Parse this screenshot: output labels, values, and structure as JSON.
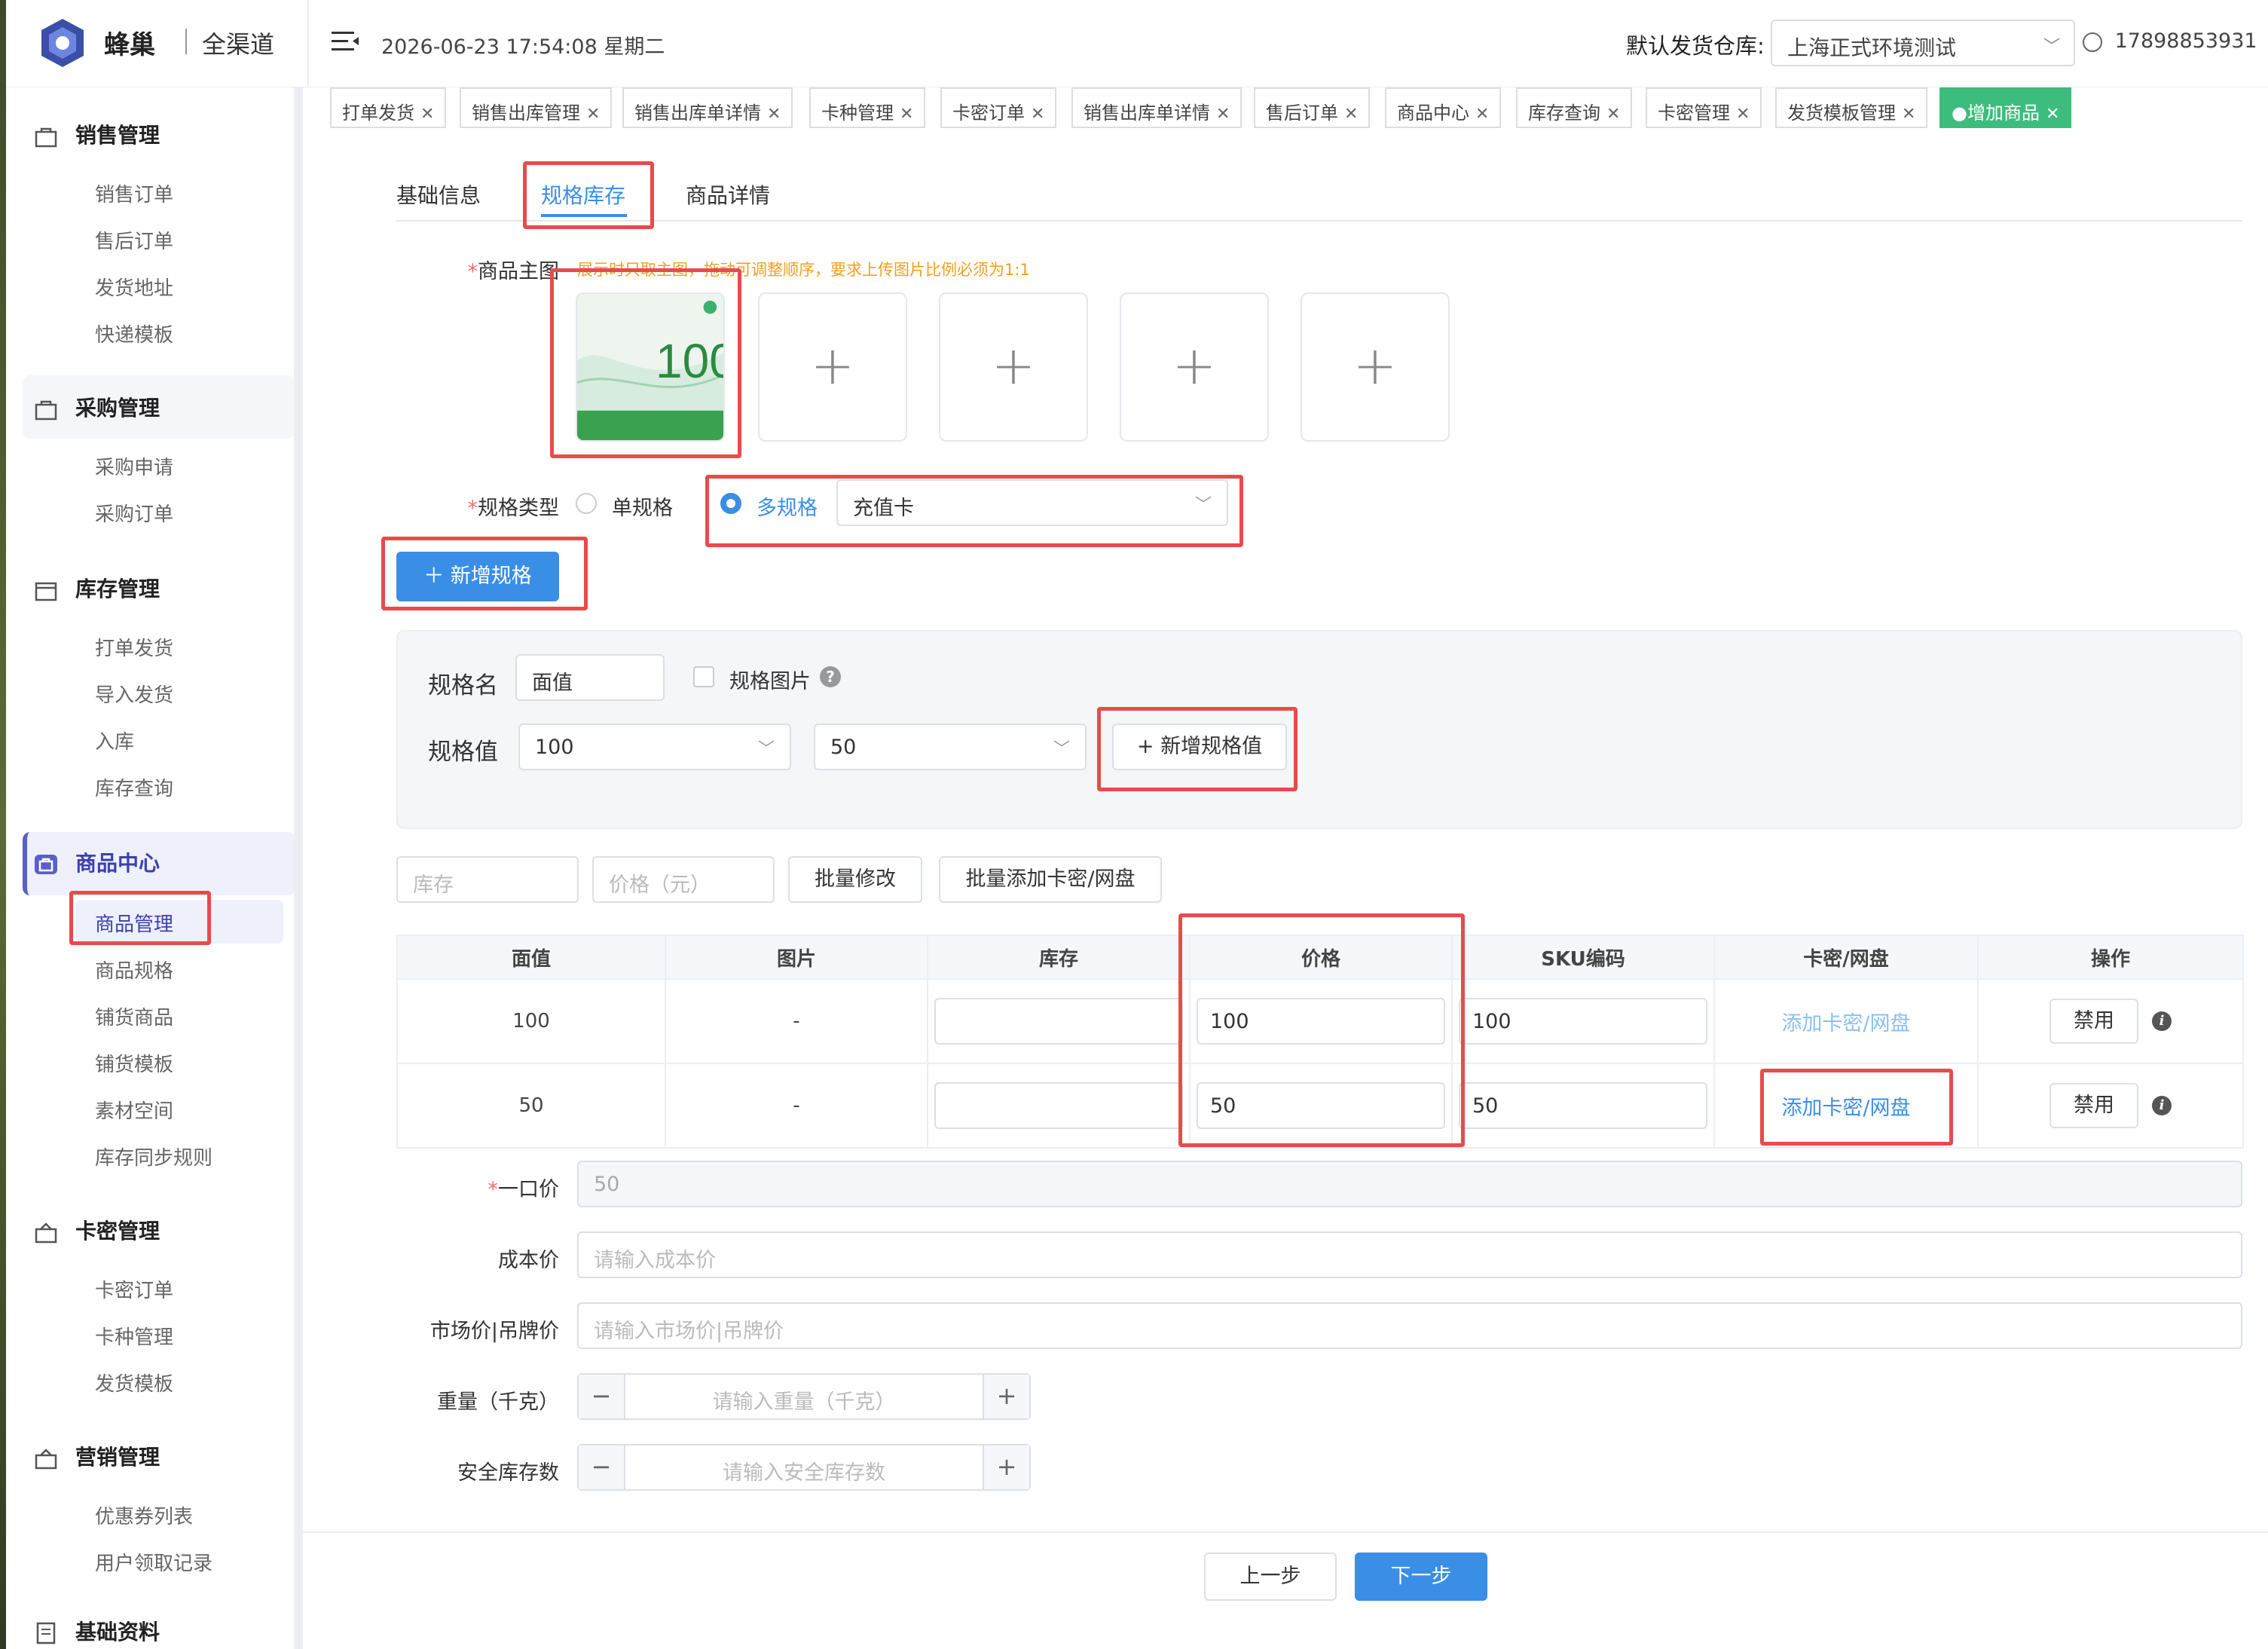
{
  "header": {
    "brand": "蜂巢",
    "brand_sub": "全渠道",
    "datetime": "2026-06-23 17:54:08 星期二",
    "warehouse_label": "默认发货仓库:",
    "warehouse_value": "上海正式环境测试",
    "user": "17898853931"
  },
  "tabs": [
    {
      "label": "打单发货"
    },
    {
      "label": "销售出库管理"
    },
    {
      "label": "销售出库单详情"
    },
    {
      "label": "卡种管理"
    },
    {
      "label": "卡密订单"
    },
    {
      "label": "销售出库单详情"
    },
    {
      "label": "售后订单"
    },
    {
      "label": "商品中心"
    },
    {
      "label": "库存查询"
    },
    {
      "label": "卡密管理"
    },
    {
      "label": "发货模板管理"
    },
    {
      "label": "●增加商品"
    }
  ],
  "sidebar": {
    "groups": [
      {
        "title": "销售管理",
        "items": [
          "销售订单",
          "售后订单",
          "发货地址",
          "快递模板"
        ]
      },
      {
        "title": "采购管理",
        "items": [
          "采购申请",
          "采购订单"
        ]
      },
      {
        "title": "库存管理",
        "items": [
          "打单发货",
          "导入发货",
          "入库",
          "库存查询"
        ]
      },
      {
        "title": "商品中心",
        "items": [
          "商品管理",
          "商品规格",
          "铺货商品",
          "铺货模板",
          "素材空间",
          "库存同步规则"
        ]
      },
      {
        "title": "卡密管理",
        "items": [
          "卡密订单",
          "卡种管理",
          "发货模板"
        ]
      },
      {
        "title": "营销管理",
        "items": [
          "优惠券列表",
          "用户领取记录"
        ]
      },
      {
        "title": "基础资料",
        "items": []
      }
    ]
  },
  "page_tabs": [
    "基础信息",
    "规格库存",
    "商品详情"
  ],
  "main_image": {
    "label": "商品主图",
    "hint": "展示时只取主图，拖动可调整顺序，要求上传图片比例必须为1:1",
    "thumb_text": "100"
  },
  "spec_type": {
    "label": "规格类型",
    "single": "单规格",
    "multi": "多规格",
    "template": "充值卡"
  },
  "add_spec_button": "新增规格",
  "spec_box": {
    "name_label": "规格名",
    "name_value": "面值",
    "image_checkbox_label": "规格图片",
    "value_label": "规格值",
    "values": [
      "100",
      "50"
    ],
    "add_value_button": "+ 新增规格值"
  },
  "batch": {
    "stock_placeholder": "库存",
    "price_placeholder": "价格（元）",
    "batch_edit": "批量修改",
    "batch_add_card": "批量添加卡密/网盘"
  },
  "sku_table": {
    "headers": [
      "面值",
      "图片",
      "库存",
      "价格",
      "SKU编码",
      "卡密/网盘",
      "操作"
    ],
    "rows": [
      {
        "face": "100",
        "image": "-",
        "stock": "",
        "price": "100",
        "sku": "100",
        "card_link": "添加卡密/网盘",
        "action": "禁用"
      },
      {
        "face": "50",
        "image": "-",
        "stock": "",
        "price": "50",
        "sku": "50",
        "card_link": "添加卡密/网盘",
        "action": "禁用"
      }
    ]
  },
  "fields": {
    "fixed_price_label": "一口价",
    "fixed_price_value": "50",
    "cost_label": "成本价",
    "cost_placeholder": "请输入成本价",
    "market_label": "市场价|吊牌价",
    "market_placeholder": "请输入市场价|吊牌价",
    "weight_label": "重量（千克）",
    "weight_placeholder": "请输入重量（千克）",
    "safety_label": "安全库存数",
    "safety_placeholder": "请输入安全库存数"
  },
  "footer": {
    "prev": "上一步",
    "next": "下一步"
  },
  "colors": {
    "primary": "#3a8ee6",
    "tab_active": "#3dbd7d",
    "highlight": "#e84b4b",
    "sidebar_accent": "#5b5fc7"
  }
}
